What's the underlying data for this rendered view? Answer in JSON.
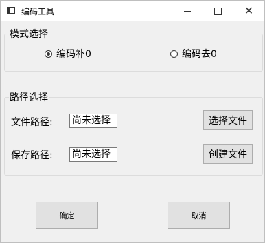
{
  "window": {
    "title": "编码工具"
  },
  "mode_group": {
    "legend": "模式选择",
    "options": [
      {
        "label": "编码补0",
        "checked": true
      },
      {
        "label": "编码去0",
        "checked": false
      }
    ]
  },
  "path_group": {
    "legend": "路径选择",
    "file_path": {
      "label": "文件路径:",
      "value": "尚未选择",
      "button": "选择文件"
    },
    "save_path": {
      "label": "保存路径:",
      "value": "尚未选择",
      "button": "创建文件"
    }
  },
  "actions": {
    "ok": "确定",
    "cancel": "取消"
  },
  "icons": {
    "app": "window-icon",
    "minimize": "minimize-icon",
    "maximize": "maximize-icon",
    "close": "close-icon"
  }
}
